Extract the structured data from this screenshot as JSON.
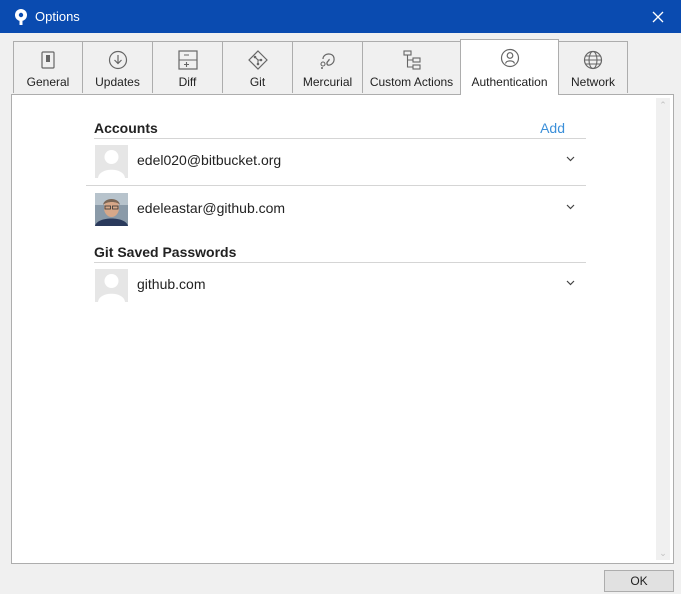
{
  "window": {
    "title": "Options",
    "close_icon": "close-icon",
    "app_icon": "sourcetree-icon",
    "title_bar_color": "#0a4bb0"
  },
  "tabs": [
    {
      "label": "General",
      "icon": "toggle-switch-icon",
      "active": false
    },
    {
      "label": "Updates",
      "icon": "download-circle-icon",
      "active": false
    },
    {
      "label": "Diff",
      "icon": "plus-minus-document-icon",
      "active": false
    },
    {
      "label": "Git",
      "icon": "git-diamond-icon",
      "active": false
    },
    {
      "label": "Mercurial",
      "icon": "mercurial-drop-icon",
      "active": false
    },
    {
      "label": "Custom Actions",
      "icon": "hierarchy-icon",
      "active": false
    },
    {
      "label": "Authentication",
      "icon": "user-circle-icon",
      "active": true
    },
    {
      "label": "Network",
      "icon": "globe-icon",
      "active": false
    }
  ],
  "accounts": {
    "heading": "Accounts",
    "add_label": "Add",
    "link_color": "#3b8fd9",
    "items": [
      {
        "name": "edel020@bitbucket.org",
        "avatar": "default-avatar"
      },
      {
        "name": "edeleastar@github.com",
        "avatar": "photo-avatar"
      }
    ]
  },
  "git_saved_passwords": {
    "heading": "Git Saved Passwords",
    "items": [
      {
        "name": "github.com",
        "avatar": "default-avatar"
      }
    ]
  },
  "footer": {
    "ok_label": "OK"
  }
}
